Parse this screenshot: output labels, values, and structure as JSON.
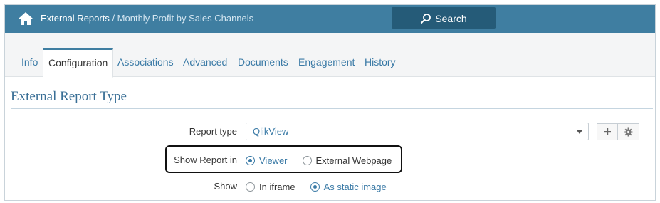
{
  "header": {
    "breadcrumb_parent": "External Reports",
    "breadcrumb_sep": " / ",
    "breadcrumb_current": "Monthly Profit by Sales Channels",
    "search_label": "Search"
  },
  "tabs": [
    {
      "label": "Info",
      "active": false
    },
    {
      "label": "Configuration",
      "active": true
    },
    {
      "label": "Associations",
      "active": false
    },
    {
      "label": "Advanced",
      "active": false
    },
    {
      "label": "Documents",
      "active": false
    },
    {
      "label": "Engagement",
      "active": false
    },
    {
      "label": "History",
      "active": false
    }
  ],
  "section": {
    "title": "External Report Type"
  },
  "form": {
    "report_type": {
      "label": "Report type",
      "value": "QlikView"
    },
    "show_report_in": {
      "label": "Show Report in",
      "options": [
        {
          "label": "Viewer",
          "selected": true
        },
        {
          "label": "External Webpage",
          "selected": false
        }
      ]
    },
    "show": {
      "label": "Show",
      "options": [
        {
          "label": "In iframe",
          "selected": false
        },
        {
          "label": "As static image",
          "selected": true
        }
      ]
    }
  },
  "colors": {
    "header_bg": "#3f7ea1",
    "search_bg": "#255b78",
    "accent": "#3a7aa6"
  },
  "icons": {
    "home": "home-icon",
    "search": "search-icon",
    "add": "plus-icon",
    "settings": "gear-icon"
  }
}
